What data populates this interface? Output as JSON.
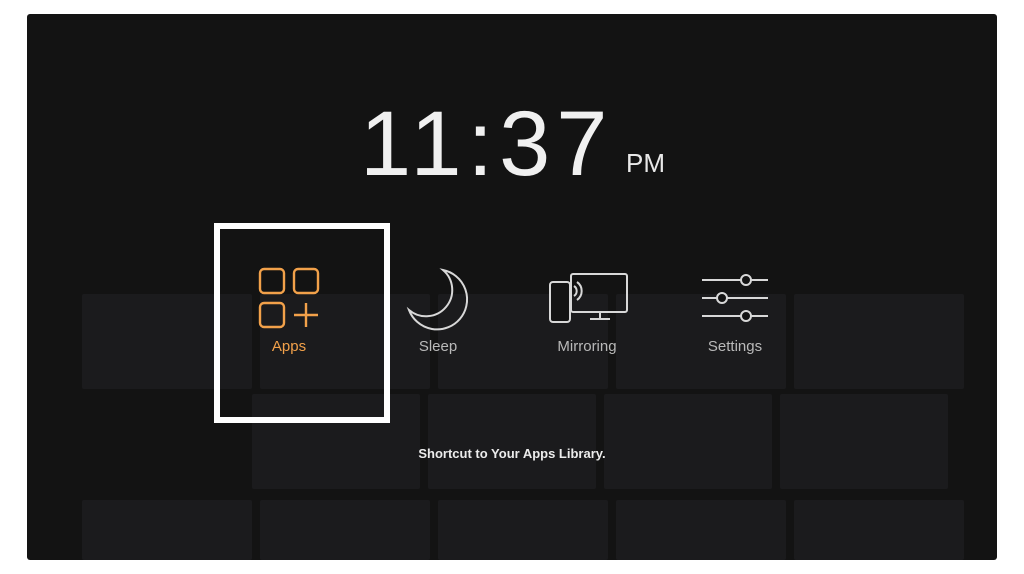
{
  "clock": {
    "time": "11:37",
    "ampm": "PM"
  },
  "quick_menu": {
    "items": [
      {
        "key": "apps",
        "label": "Apps",
        "icon": "apps-grid-icon",
        "selected": true
      },
      {
        "key": "sleep",
        "label": "Sleep",
        "icon": "moon-icon",
        "selected": false
      },
      {
        "key": "mirroring",
        "label": "Mirroring",
        "icon": "mirroring-icon",
        "selected": false
      },
      {
        "key": "settings",
        "label": "Settings",
        "icon": "sliders-icon",
        "selected": false
      }
    ]
  },
  "hint": "Shortcut to Your Apps Library.",
  "colors": {
    "accent": "#f2a14a",
    "focus_border": "#ffffff",
    "background": "#131313",
    "label": "#b9b9b9"
  }
}
